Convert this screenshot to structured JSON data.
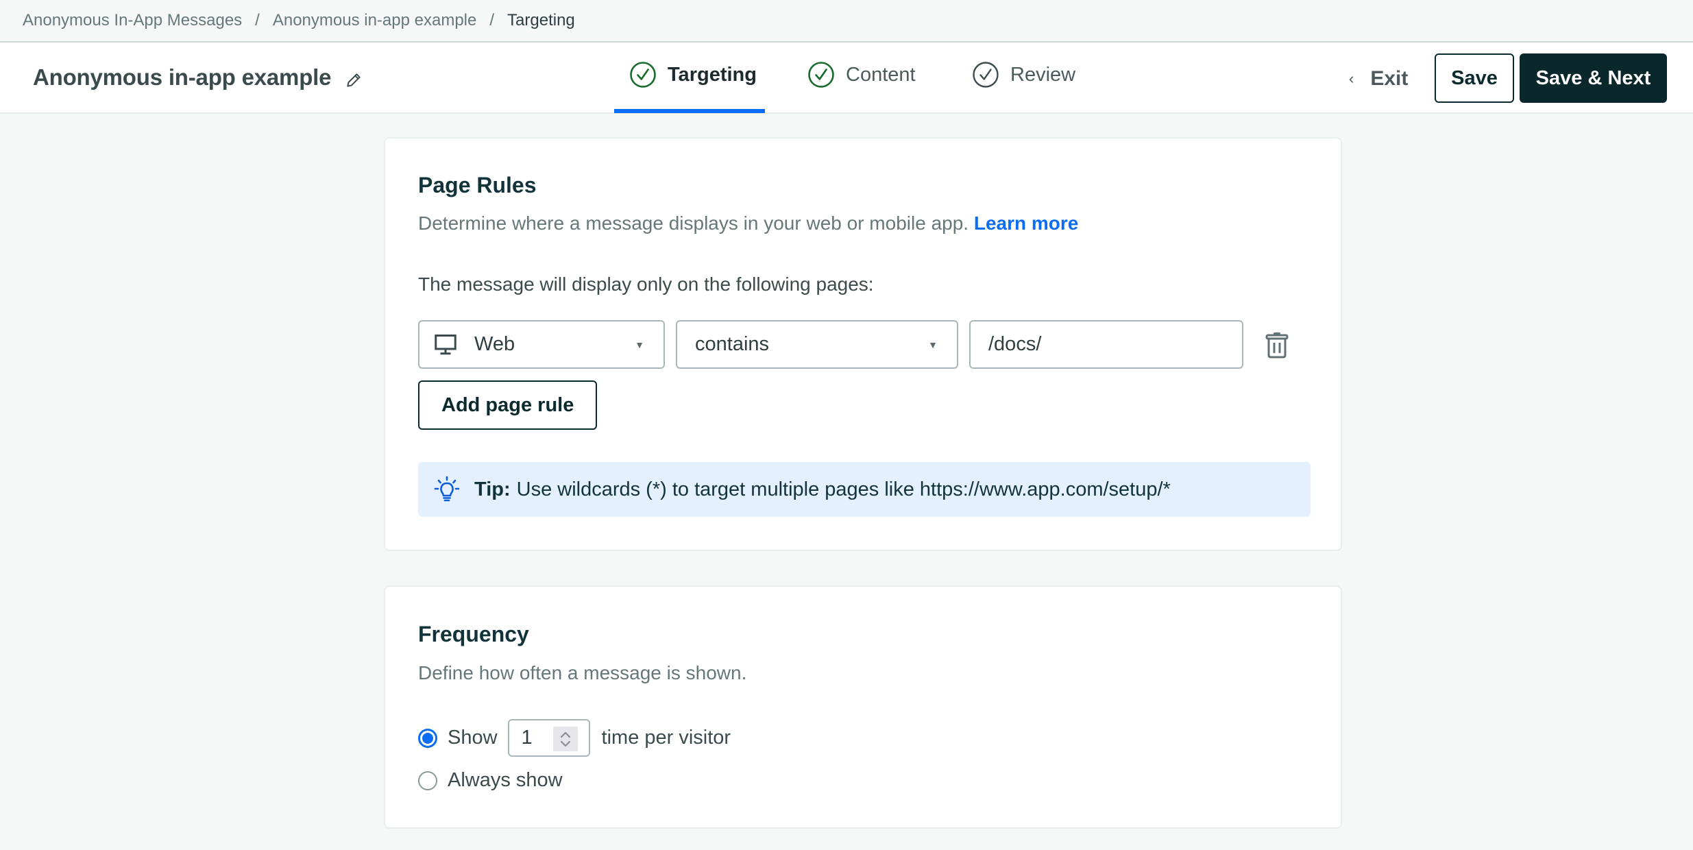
{
  "breadcrumb": {
    "items": [
      "Anonymous In-App Messages",
      "Anonymous in-app example",
      "Targeting"
    ],
    "separator": "/"
  },
  "header": {
    "title": "Anonymous in-app example",
    "edit_icon": "pencil-icon",
    "steps": [
      {
        "label": "Targeting",
        "state": "complete",
        "active": true,
        "icon": "check-circle-icon"
      },
      {
        "label": "Content",
        "state": "complete",
        "active": false,
        "icon": "check-circle-icon"
      },
      {
        "label": "Review",
        "state": "pending",
        "active": false,
        "icon": "check-circle-icon"
      }
    ],
    "exit_label": "Exit",
    "exit_icon": "chevron-left-icon",
    "save_label": "Save",
    "save_next_label": "Save & Next"
  },
  "page_rules": {
    "title": "Page Rules",
    "description": "Determine where a message displays in your web or mobile app.",
    "learn_more": "Learn more",
    "rules_label": "The message will display only on the following pages:",
    "rules": [
      {
        "platform": "Web",
        "platform_icon": "desktop-icon",
        "operator": "contains",
        "value": "/docs/",
        "delete_icon": "trash-icon"
      }
    ],
    "add_rule_label": "Add page rule",
    "tip": {
      "icon": "lightbulb-icon",
      "prefix": "Tip:",
      "text": "Use wildcards (*) to target multiple pages like https://www.app.com/setup/*"
    }
  },
  "frequency": {
    "title": "Frequency",
    "description": "Define how often a message is shown.",
    "options": [
      {
        "id": "show",
        "label_before": "Show",
        "count": "1",
        "label_after": "time per visitor",
        "selected": true
      },
      {
        "id": "always",
        "label": "Always show",
        "selected": false
      }
    ]
  },
  "colors": {
    "accent": "#0b6ef2",
    "primary_dark": "#0a272b",
    "success": "#166b2a",
    "tip_bg": "#e4f0fd",
    "page_bg": "#f6f8f8"
  }
}
